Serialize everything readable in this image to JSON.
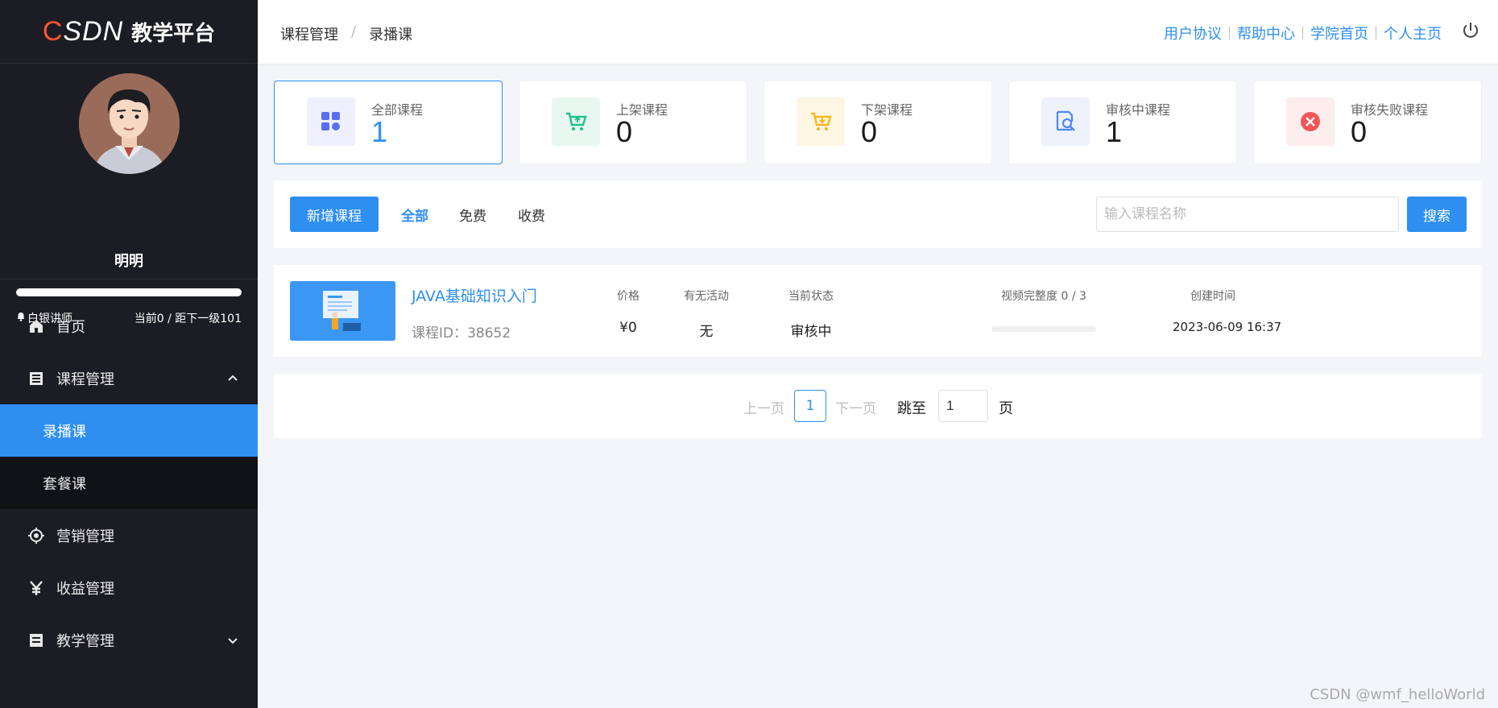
{
  "sidebar": {
    "brand_c": "C",
    "brand_rest": "SDN",
    "brand_title": "教学平台",
    "username": "明明",
    "level_progress": 0,
    "level_name": "白银讲师",
    "level_status": "当前0 / 距下一级101",
    "nav": [
      {
        "label": "首页",
        "icon": "home-icon"
      },
      {
        "label": "课程管理",
        "icon": "list-icon",
        "expanded": true
      },
      {
        "label": "营销管理",
        "icon": "target-icon"
      },
      {
        "label": "收益管理",
        "icon": "yen-icon"
      },
      {
        "label": "教学管理",
        "icon": "book-icon",
        "expanded": false
      }
    ],
    "subnav": [
      {
        "label": "录播课",
        "active": true
      },
      {
        "label": "套餐课",
        "active": false
      }
    ]
  },
  "header": {
    "breadcrumb": [
      "课程管理",
      "录播课"
    ],
    "breadcrumb_sep": "/",
    "links": [
      "用户协议",
      "帮助中心",
      "学院首页",
      "个人主页"
    ]
  },
  "stats": [
    {
      "label": "全部课程",
      "value": "1",
      "icon": "grid-icon",
      "color": "#5a6ff0",
      "bg": "#eef0fd"
    },
    {
      "label": "上架课程",
      "value": "0",
      "icon": "cart-up-icon",
      "color": "#22c08a",
      "bg": "#e8f8f1"
    },
    {
      "label": "下架课程",
      "value": "0",
      "icon": "cart-down-icon",
      "color": "#f5b61f",
      "bg": "#fdf6e3"
    },
    {
      "label": "审核中课程",
      "value": "1",
      "icon": "review-icon",
      "color": "#4f86f0",
      "bg": "#edf2fd"
    },
    {
      "label": "审核失败课程",
      "value": "0",
      "icon": "fail-icon",
      "color": "#f25656",
      "bg": "#fdeeee"
    }
  ],
  "toolbar": {
    "add_label": "新增课程",
    "filters": [
      "全部",
      "免费",
      "收费"
    ],
    "search_placeholder": "输入课程名称",
    "search_label": "搜索"
  },
  "course": {
    "name": "JAVA基础知识入门",
    "id_text": "课程ID：38652",
    "headers": {
      "price": "价格",
      "activity": "有无活动",
      "status": "当前状态",
      "video": "视频完整度 0 / 3",
      "created": "创建时间"
    },
    "price": "¥0",
    "activity": "无",
    "status": "审核中",
    "video_progress": 0,
    "created": "2023-06-09 16:37"
  },
  "pager": {
    "prev": "上一页",
    "current": "1",
    "next": "下一页",
    "jump": "跳至",
    "jump_value": "1",
    "page": "页"
  },
  "watermark": "CSDN @wmf_helloWorld",
  "colors": {
    "accent": "#2e8ff0",
    "sidebar_bg": "#1c1d24",
    "brand_red": "#fc5531"
  }
}
